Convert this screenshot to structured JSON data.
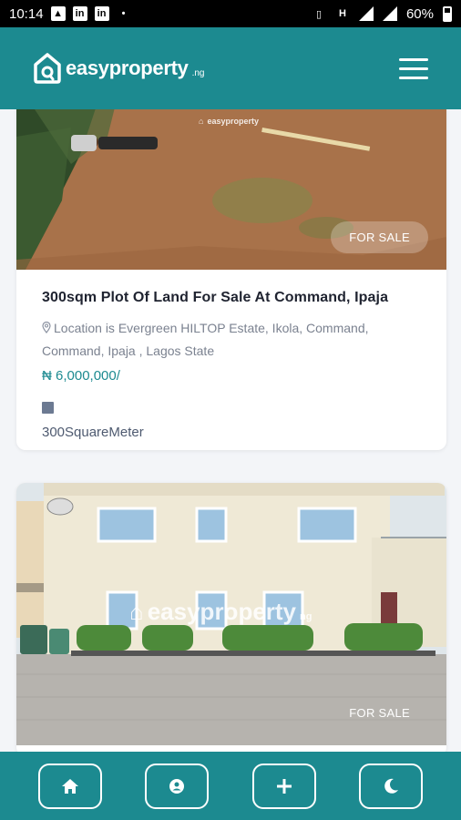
{
  "status_bar": {
    "time": "10:14",
    "battery": "60%",
    "icons": [
      "image-icon",
      "linkedin-icon",
      "linkedin-icon",
      "dot-icon",
      "vibrate-icon",
      "h-signal-icon",
      "signal-icon",
      "signal-icon",
      "battery-icon"
    ]
  },
  "header": {
    "logo_text": "easyproperty",
    "logo_suffix": ".ng",
    "menu_icon": "hamburger-menu-icon"
  },
  "listings": [
    {
      "badge": "FOR SALE",
      "title": "300sqm Plot Of Land For Sale At Command, Ipaja",
      "location": "Location is Evergreen HILTOP Estate, Ikola, Command, Command, Ipaja , Lagos State",
      "price": "₦ 6,000,000/",
      "size": "300SquareMeter"
    },
    {
      "badge": "FOR SALE",
      "watermark": "easyproperty",
      "watermark_suffix": "ng"
    }
  ],
  "bottom_nav": {
    "items": [
      "home-icon",
      "account-icon",
      "add-icon",
      "dark-mode-icon"
    ]
  },
  "colors": {
    "brand": "#1c8a90",
    "price": "#1c8a90",
    "text_dark": "#1f2330",
    "text_muted": "#7b8290"
  }
}
